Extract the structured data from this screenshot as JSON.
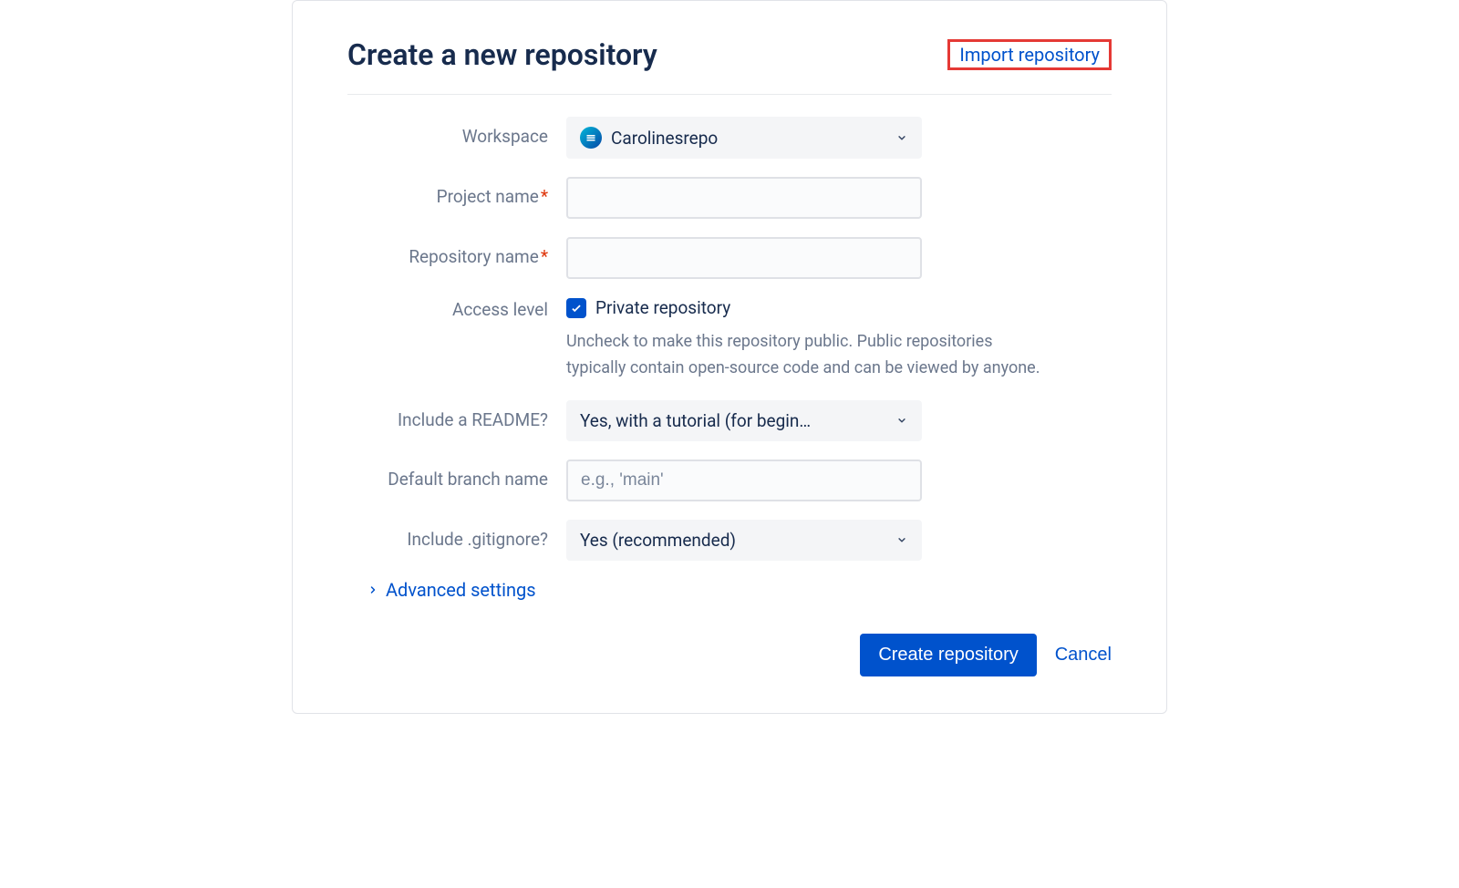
{
  "header": {
    "title": "Create a new repository",
    "import_link": "Import repository"
  },
  "form": {
    "workspace": {
      "label": "Workspace",
      "value": "Carolinesrepo"
    },
    "project_name": {
      "label": "Project name",
      "required": true,
      "value": ""
    },
    "repository_name": {
      "label": "Repository name",
      "required": true,
      "value": ""
    },
    "access_level": {
      "label": "Access level",
      "checkbox_label": "Private repository",
      "checked": true,
      "help_text": "Uncheck to make this repository public. Public repositories typically contain open-source code and can be viewed by anyone."
    },
    "readme": {
      "label": "Include a README?",
      "value": "Yes, with a tutorial (for begin…"
    },
    "default_branch": {
      "label": "Default branch name",
      "placeholder": "e.g., 'main'",
      "value": ""
    },
    "gitignore": {
      "label": "Include .gitignore?",
      "value": "Yes (recommended)"
    },
    "advanced_toggle": "Advanced settings"
  },
  "buttons": {
    "create": "Create repository",
    "cancel": "Cancel"
  }
}
